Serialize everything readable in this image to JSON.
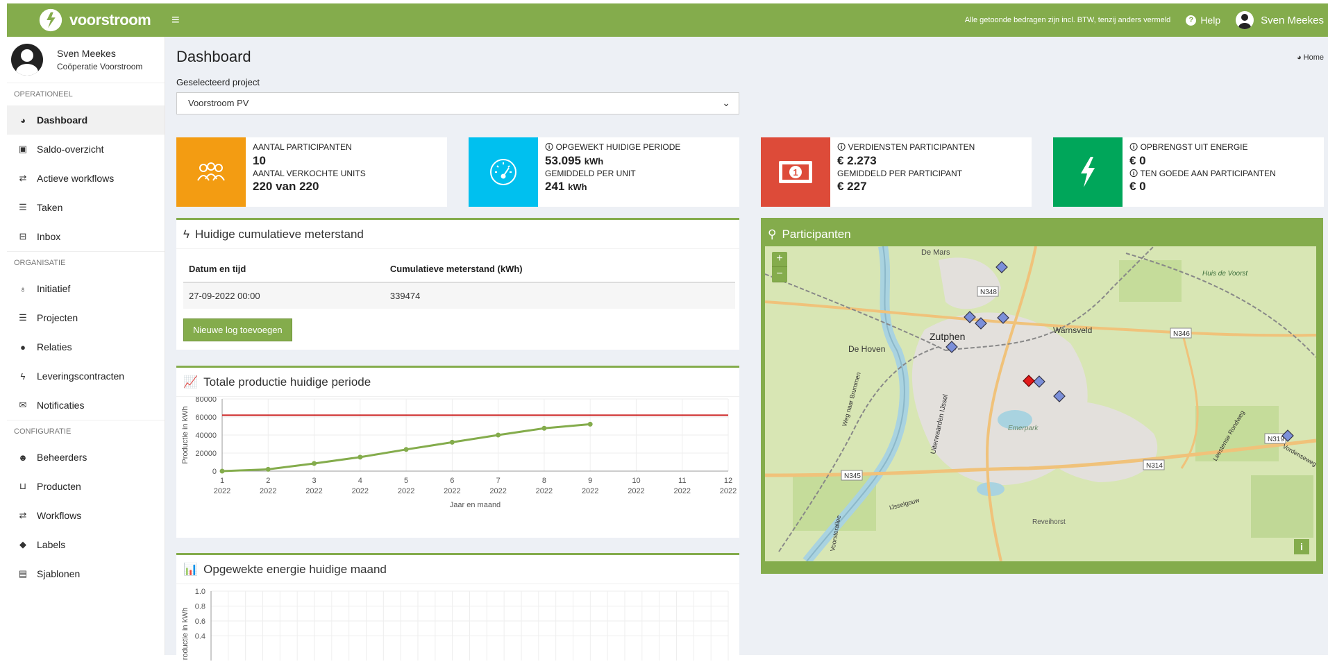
{
  "app": {
    "brand": "voorstroom"
  },
  "topbar": {
    "note": "Alle getoonde bedragen zijn incl. BTW, tenzij anders vermeld",
    "help_label": "Help",
    "user_name": "Sven Meekes"
  },
  "sidebar": {
    "profile_name": "Sven Meekes",
    "profile_org": "Coöperatie Voorstroom",
    "sections": [
      {
        "title": "OPERATIONEEL"
      },
      {
        "title": "ORGANISATIE"
      },
      {
        "title": "CONFIGURATIE"
      }
    ],
    "items": [
      {
        "label": "Dashboard",
        "icon": "dashboard-icon"
      },
      {
        "label": "Saldo-overzicht",
        "icon": "money-icon"
      },
      {
        "label": "Actieve workflows",
        "icon": "exchange-icon"
      },
      {
        "label": "Taken",
        "icon": "tasks-icon"
      },
      {
        "label": "Inbox",
        "icon": "inbox-icon"
      },
      {
        "label": "Initiatief",
        "icon": "lightbulb-icon"
      },
      {
        "label": "Projecten",
        "icon": "list-icon"
      },
      {
        "label": "Relaties",
        "icon": "user-icon"
      },
      {
        "label": "Leveringscontracten",
        "icon": "bolt-icon"
      },
      {
        "label": "Notificaties",
        "icon": "envelope-icon"
      },
      {
        "label": "Beheerders",
        "icon": "users-icon"
      },
      {
        "label": "Producten",
        "icon": "shopping-basket-icon"
      },
      {
        "label": "Workflows",
        "icon": "exchange-icon"
      },
      {
        "label": "Labels",
        "icon": "tags-icon"
      },
      {
        "label": "Sjablonen",
        "icon": "file-icon"
      }
    ]
  },
  "main": {
    "title": "Dashboard",
    "breadcrumb": "Home",
    "select_label": "Geselecteerd project",
    "select_value": "Voorstroom PV"
  },
  "info_boxes": [
    {
      "color": "#f39c12",
      "icon": "users-icon",
      "l1": "AANTAL PARTICIPANTEN",
      "v1": "10",
      "u1": "",
      "l2": "AANTAL VERKOCHTE UNITS",
      "v2": "220 van 220",
      "u2": ""
    },
    {
      "color": "#00c0ef",
      "icon": "tachometer-icon",
      "l1": "OPGEWEKT HUIDIGE PERIODE",
      "v1": "53.095",
      "u1": "kWh",
      "l2": "GEMIDDELD PER UNIT",
      "v2": "241",
      "u2": "kWh"
    },
    {
      "color": "#dd4b39",
      "icon": "money-icon",
      "l1": "VERDIENSTEN PARTICIPANTEN",
      "v1": "€ 2.273",
      "u1": "",
      "l2": "GEMIDDELD PER PARTICIPANT",
      "v2": "€ 227",
      "u2": ""
    },
    {
      "color": "#00a65a",
      "icon": "bolt-icon",
      "l1": "OPBRENGST UIT ENERGIE",
      "v1": "€ 0",
      "u1": "",
      "l2": "TEN GOEDE AAN PARTICIPANTEN",
      "v2": "€ 0",
      "u2": ""
    }
  ],
  "meter_panel": {
    "title": "Huidige cumulatieve meterstand",
    "headers": [
      "Datum en tijd",
      "Cumulatieve meterstand (kWh)"
    ],
    "rows": [
      [
        "27-09-2022 00:00",
        "339474"
      ]
    ],
    "button": "Nieuwe log toevoegen"
  },
  "production_panel": {
    "title": "Totale productie huidige periode"
  },
  "month_panel": {
    "title": "Opgewekte energie huidige maand"
  },
  "map_panel": {
    "title": "Participanten",
    "labels": [
      "De Mars",
      "N348",
      "Zutphen",
      "Warnsveld",
      "N346",
      "De Hoven",
      "Emerpark",
      "N319",
      "N314",
      "N345",
      "Reveihorst",
      "Huis de Voorst",
      "Uiterwaarden IJssel",
      "Vordenseweg",
      "IJsselgouw",
      "Leestense Rondweg",
      "Weg naar Brummen",
      "Voorsterallee"
    ],
    "zoom_in": "+",
    "zoom_out": "−",
    "info": "i"
  },
  "chart_data": [
    {
      "type": "line",
      "title": "Totale productie huidige periode",
      "xlabel": "Jaar en maand",
      "ylabel": "Productie in kWh",
      "categories": [
        "1 2022",
        "2 2022",
        "3 2022",
        "4 2022",
        "5 2022",
        "6 2022",
        "7 2022",
        "8 2022",
        "9 2022",
        "10 2022",
        "11 2022",
        "12 2022"
      ],
      "series": [
        {
          "values": [
            0,
            2000,
            8500,
            15500,
            24000,
            32000,
            40000,
            47500,
            52000,
            null,
            null,
            null
          ],
          "color": "#84ac4c"
        },
        {
          "values": [
            62000,
            62000,
            62000,
            62000,
            62000,
            62000,
            62000,
            62000,
            62000,
            62000,
            62000,
            62000
          ],
          "color": "#cc2222"
        }
      ],
      "ylim": [
        0,
        80000
      ],
      "yticks": [
        "0",
        "20000",
        "40000",
        "60000",
        "80000"
      ],
      "grid": true
    },
    {
      "type": "bar",
      "title": "Opgewekte energie huidige maand",
      "ylabel": "Productie in kWh",
      "ylim": [
        0,
        1.0
      ],
      "yticks": [
        "0.4",
        "0.6",
        "0.8",
        "1.0"
      ],
      "grid": true
    }
  ]
}
